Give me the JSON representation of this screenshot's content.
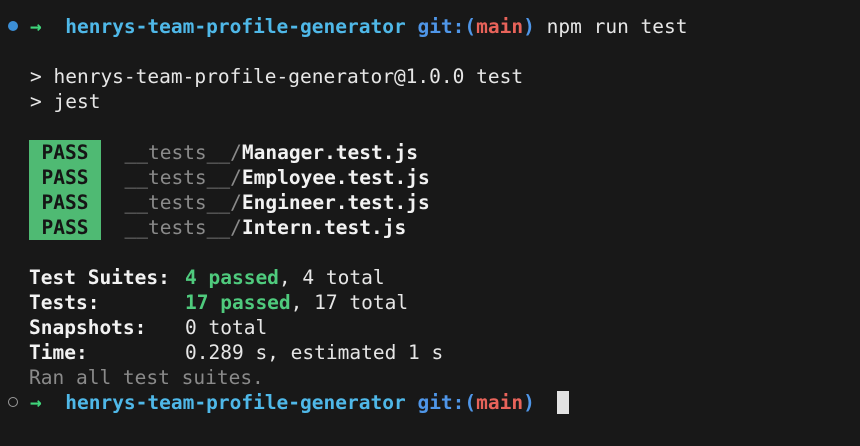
{
  "prompt": {
    "arrow": "→",
    "dir": "henrys-team-profile-generator",
    "git_label": "git:",
    "paren_open": "(",
    "branch": "main",
    "paren_close": ")"
  },
  "command": "npm run test",
  "npm_output": [
    "> henrys-team-profile-generator@1.0.0 test",
    "> jest"
  ],
  "results": [
    {
      "status": "PASS",
      "dir": "__tests__/",
      "file": "Manager.test.js"
    },
    {
      "status": "PASS",
      "dir": "__tests__/",
      "file": "Employee.test.js"
    },
    {
      "status": "PASS",
      "dir": "__tests__/",
      "file": "Engineer.test.js"
    },
    {
      "status": "PASS",
      "dir": "__tests__/",
      "file": "Intern.test.js"
    }
  ],
  "summary": {
    "suites_label": "Test Suites:",
    "suites_passed": "4 passed",
    "suites_total": ", 4 total",
    "tests_label": "Tests:",
    "tests_passed": "17 passed",
    "tests_total": ", 17 total",
    "snapshots_label": "Snapshots:",
    "snapshots_value": "0 total",
    "time_label": "Time:",
    "time_value": "0.289 s, estimated 1 s",
    "ran_all": "Ran all test suites."
  },
  "colors": {
    "background": "#181818",
    "pass_badge": "#4fba73",
    "prompt_arrow": "#3fd67b",
    "directory": "#4fb8e8",
    "branch": "#e8635a"
  }
}
